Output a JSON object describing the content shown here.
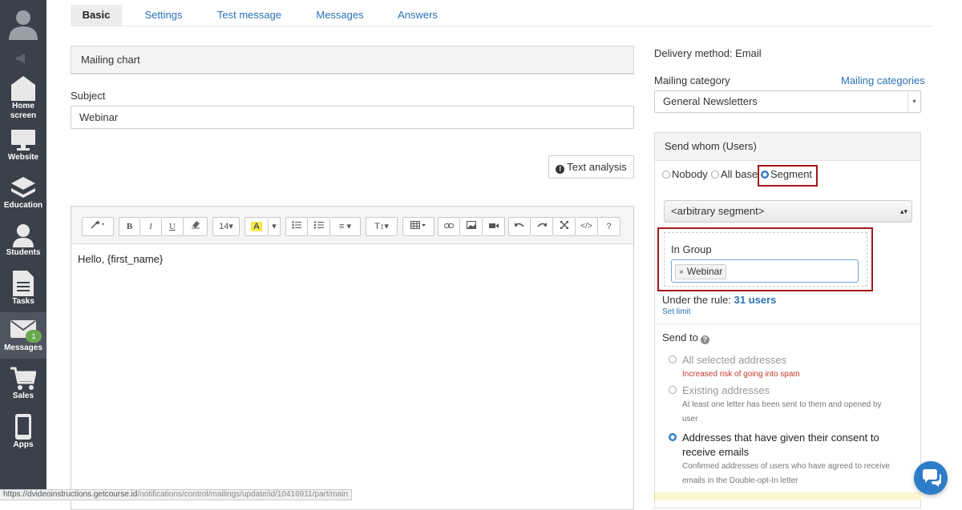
{
  "sidebar": {
    "items": [
      {
        "label_line1": "Home",
        "label_line2": "screen",
        "icon": "house-icon"
      },
      {
        "label": "Website",
        "icon": "monitor-icon"
      },
      {
        "label": "Education",
        "icon": "layers-icon"
      },
      {
        "label": "Students",
        "icon": "person-icon"
      },
      {
        "label": "Tasks",
        "icon": "document-icon"
      },
      {
        "label": "Messages",
        "icon": "envelope-icon",
        "badge": "1"
      },
      {
        "label": "Sales",
        "icon": "cart-icon"
      },
      {
        "label": "Apps",
        "icon": "phone-icon"
      }
    ]
  },
  "tabs": {
    "basic": "Basic",
    "settings": "Settings",
    "test_message": "Test message",
    "messages": "Messages",
    "answers": "Answers"
  },
  "main": {
    "mailing_chart": "Mailing chart",
    "subject_label": "Subject",
    "subject_value": "Webinar",
    "text_analysis": "Text analysis",
    "editor_body": "Hello, {first_name}",
    "toolbar": {
      "font_size": "14",
      "align_icon": "≡",
      "text_style_icon": "T↕",
      "help": "?"
    }
  },
  "right": {
    "delivery_method": "Delivery method: Email",
    "mailing_category_label": "Mailing category",
    "mailing_categories_link": "Mailing categories",
    "mailing_category_value": "General Newsletters",
    "send_whom_title": "Send whom (Users)",
    "radio_nobody": "Nobody",
    "radio_all_base": "All base",
    "radio_segment": "Segment",
    "segment_select": "<arbitrary segment>",
    "in_group_label": "In Group",
    "group_chip": "Webinar",
    "rule_prefix": "Under the rule:",
    "rule_count": "31 users",
    "set_limit": "Set limit",
    "send_to_label": "Send to",
    "opt1_title": "All selected addresses",
    "opt1_note": "Increased risk of going into spam",
    "opt2_title": "Existing addresses",
    "opt2_note": "At least one letter has been sent to them and opened by user",
    "opt3_title": "Addresses that have given their consent to receive emails",
    "opt3_note": "Confirmed addresses of users who have agreed to receive emails in the Double-opt-In letter"
  },
  "status": {
    "url_host": "https://dvideoinstructions.getcourse.id",
    "url_path": "/notifications/control/mailings/update/id/10416911/part/main"
  },
  "colors": {
    "sidebar_bg": "#3b414b",
    "link": "#2a72b5",
    "highlight_border": "#a3161a",
    "badge": "#6aa84f",
    "chat_fab": "#2d7cc8"
  }
}
